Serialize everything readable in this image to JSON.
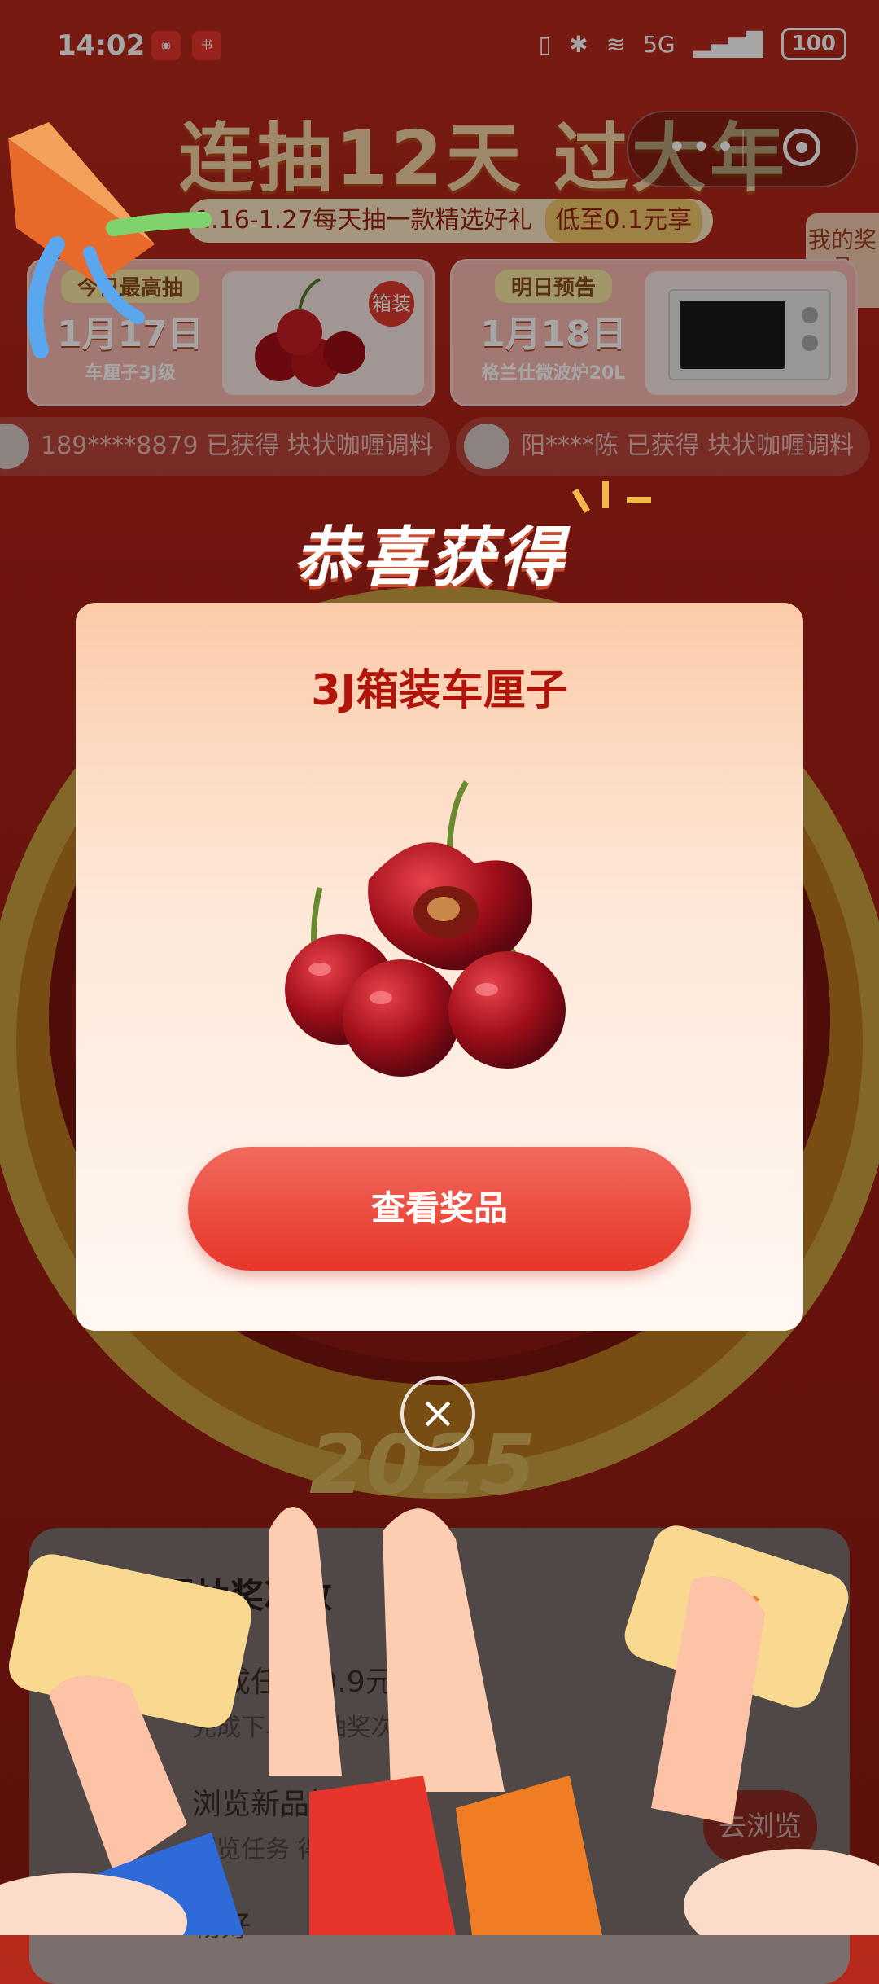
{
  "status_bar": {
    "time": "14:02",
    "network": "5G",
    "battery": "100"
  },
  "header": {
    "title": "连抽12天 过大年",
    "subtitle": "1.16-1.27每天抽一款精选好礼",
    "subtitle_highlight": "低至0.1元享",
    "my_prize": "我的奖品"
  },
  "day_cards": [
    {
      "tag": "今日最高抽",
      "date": "1月17日",
      "name": "车厘子3J级",
      "badge": "箱装"
    },
    {
      "tag": "明日预告",
      "date": "1月18日",
      "name": "格兰仕微波炉20L"
    }
  ],
  "winners": [
    {
      "text": "189****8879 已获得 块状咖喱调料"
    },
    {
      "text": "阳****陈 已获得 块状咖喱调料"
    }
  ],
  "modal": {
    "heading": "恭喜获得",
    "prize_name": "3J箱装车厘子",
    "cta": "查看奖品"
  },
  "background_logo": "2025",
  "tasks": {
    "title": "做任务得抽奖次数",
    "items": [
      {
        "title": "完成任务 9.9元",
        "sub": "完成下单 得抽奖次数"
      },
      {
        "title": "浏览新品推荐（0",
        "sub": "浏览任务 得抽奖次数",
        "button": "去浏览"
      },
      {
        "title": "物好"
      }
    ]
  },
  "colors": {
    "brand_red": "#e8362a",
    "title_gold": "#f3d5a3",
    "prize_text": "#b0140a"
  }
}
